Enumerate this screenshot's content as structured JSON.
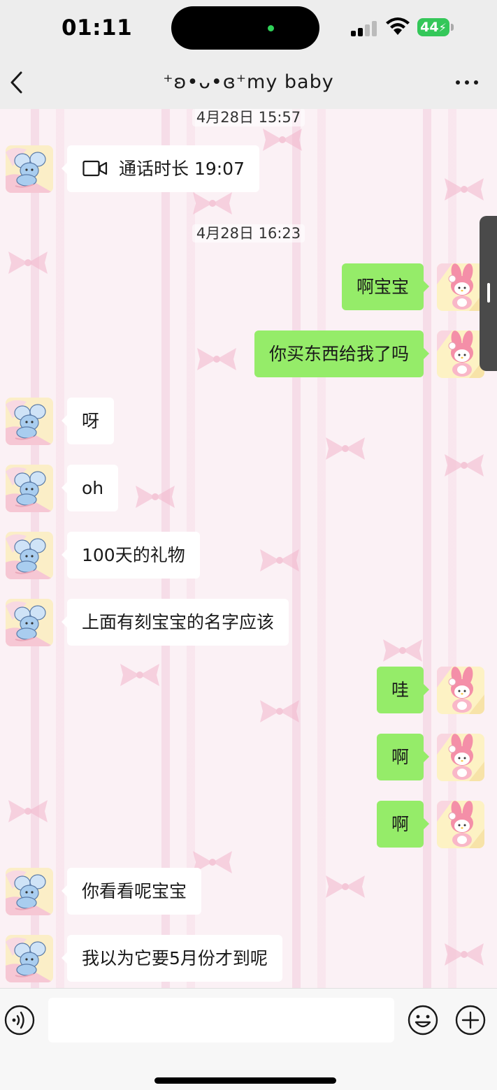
{
  "status_bar": {
    "time": "01:11",
    "battery": "44"
  },
  "header": {
    "title": "⁺ʚ•ᴗ•ɞ⁺my  baby"
  },
  "messages": [
    {
      "type": "timestamp",
      "text": "4月28日 15:57"
    },
    {
      "type": "call",
      "side": "left",
      "text": "通话时长 19:07"
    },
    {
      "type": "timestamp",
      "text": "4月28日 16:23"
    },
    {
      "type": "text",
      "side": "right",
      "text": "啊宝宝"
    },
    {
      "type": "text",
      "side": "right",
      "text": "你买东西给我了吗"
    },
    {
      "type": "text",
      "side": "left",
      "text": "呀"
    },
    {
      "type": "text",
      "side": "left",
      "text": "oh"
    },
    {
      "type": "text",
      "side": "left",
      "text": "100天的礼物"
    },
    {
      "type": "text",
      "side": "left",
      "text": "上面有刻宝宝的名字应该"
    },
    {
      "type": "text",
      "side": "right",
      "text": "哇"
    },
    {
      "type": "text",
      "side": "right",
      "text": "啊"
    },
    {
      "type": "text",
      "side": "right",
      "text": "啊"
    },
    {
      "type": "text",
      "side": "left",
      "text": "你看看呢宝宝"
    },
    {
      "type": "text",
      "side": "left",
      "text": "我以为它要5月份才到呢"
    }
  ],
  "colors": {
    "sent_bubble": "#95ec69",
    "received_bubble": "#ffffff",
    "chat_background": "#fbf1f5"
  },
  "icons": [
    "chevron-left-icon",
    "more-icon",
    "video-call-icon",
    "voice-icon",
    "emoji-icon",
    "plus-icon"
  ]
}
